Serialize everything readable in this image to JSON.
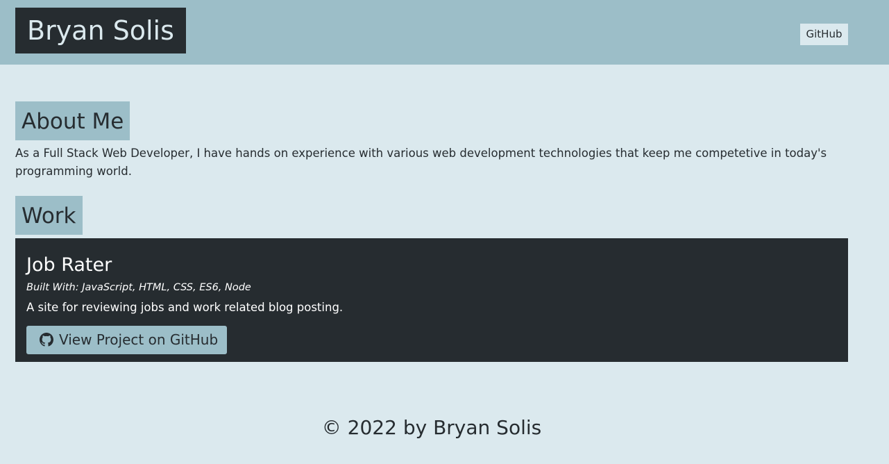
{
  "header": {
    "brand": "Bryan Solis",
    "nav_link": "GitHub"
  },
  "about": {
    "heading": "About Me",
    "text": "As a Full Stack Web Developer, I have hands on experience with various web development technologies that keep me competetive in today's programming world."
  },
  "work": {
    "heading": "Work",
    "projects": [
      {
        "title": "Job Rater",
        "tech": "Built With: JavaScript, HTML, CSS, ES6, Node",
        "description": "A site for reviewing jobs and work related blog posting.",
        "button_label": "View Project on GitHub",
        "button_icon": "github-icon"
      }
    ]
  },
  "footer": {
    "text": "© 2022 by Bryan Solis"
  },
  "colors": {
    "page_background": "#dbe9ee",
    "header_background": "#9cbec8",
    "dark": "#262c30",
    "accent": "#9cbec8"
  }
}
